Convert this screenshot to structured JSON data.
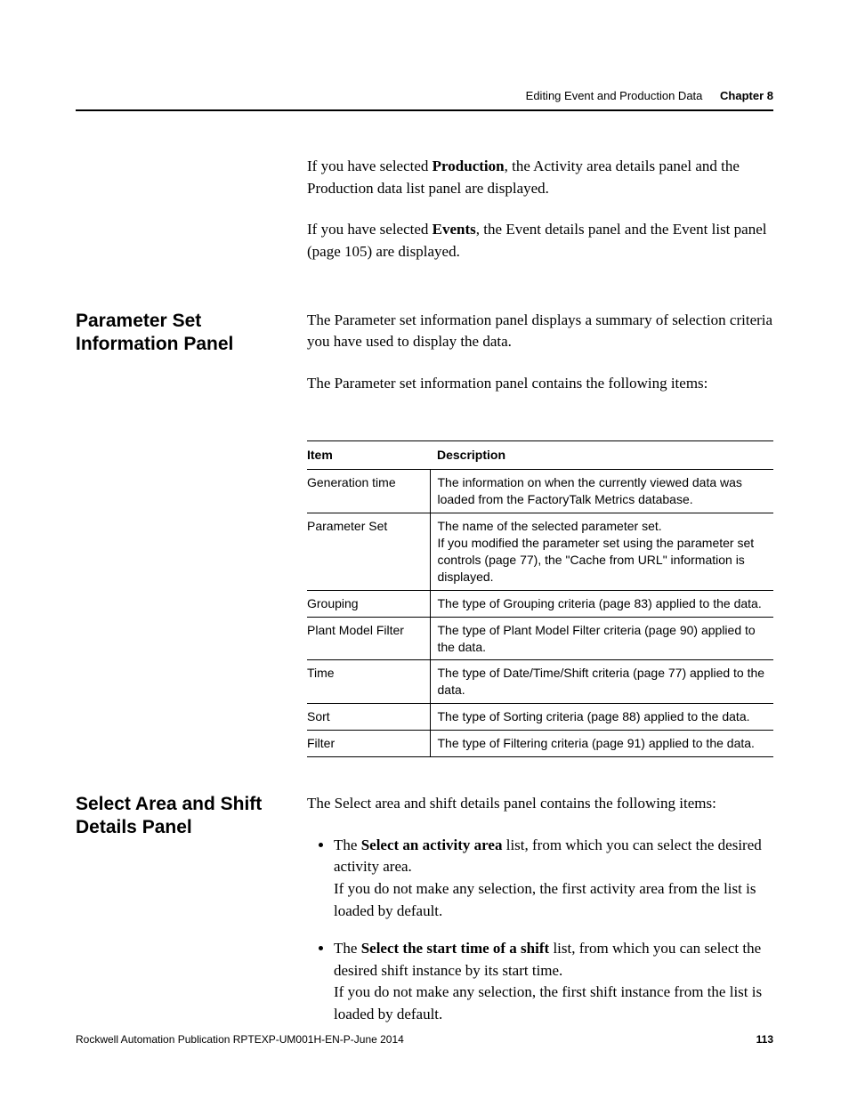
{
  "header": {
    "section_title": "Editing Event and Production Data",
    "chapter_label": "Chapter 8"
  },
  "intro": {
    "p1_pre": "If you have selected ",
    "p1_bold": "Production",
    "p1_post": ", the Activity area details panel and the Production data list panel are displayed.",
    "p2_pre": "If you have selected ",
    "p2_bold": "Events",
    "p2_post": ", the Event details panel and the Event list panel (page 105) are displayed."
  },
  "param_panel": {
    "heading": "Parameter Set Information Panel",
    "p1": "The Parameter set information panel displays a summary of selection criteria you have used to display the data.",
    "p2": "The Parameter set information panel contains the following items:"
  },
  "table": {
    "col1": "Item",
    "col2": "Description",
    "rows": [
      {
        "item": "Generation time",
        "desc": "The information on when the currently viewed data was loaded from the FactoryTalk Metrics database."
      },
      {
        "item": "Parameter Set",
        "desc": "The name of the selected parameter set.\nIf you modified the parameter set using the parameter set controls (page 77), the \"Cache from URL\" information is displayed."
      },
      {
        "item": "Grouping",
        "desc": "The type of Grouping criteria (page 83) applied to the data."
      },
      {
        "item": "Plant Model Filter",
        "desc": "The type of Plant Model Filter criteria (page 90) applied to the data."
      },
      {
        "item": "Time",
        "desc": "The type of Date/Time/Shift criteria (page 77) applied to the data."
      },
      {
        "item": "Sort",
        "desc": "The type of Sorting criteria (page 88) applied to the data."
      },
      {
        "item": "Filter",
        "desc": "The type of Filtering criteria (page 91) applied to the data."
      }
    ]
  },
  "select_panel": {
    "heading": "Select Area and Shift Details Panel",
    "p1": "The Select area and shift details panel contains the following items:",
    "bullets": [
      {
        "lead": "The ",
        "bold": "Select an activity area",
        "tail": " list, from which you can select the desired activity area.",
        "line2": "If you do not make any selection, the first activity area from the list is loaded by default."
      },
      {
        "lead": "The ",
        "bold": "Select the start time of a shift",
        "tail": " list, from which you can select the desired shift instance by its start time.",
        "line2": "If you do not make any selection, the first shift instance from the list is loaded by default."
      }
    ]
  },
  "footer": {
    "publication": "Rockwell Automation Publication RPTEXP-UM001H-EN-P-June 2014",
    "pageno": "113"
  }
}
